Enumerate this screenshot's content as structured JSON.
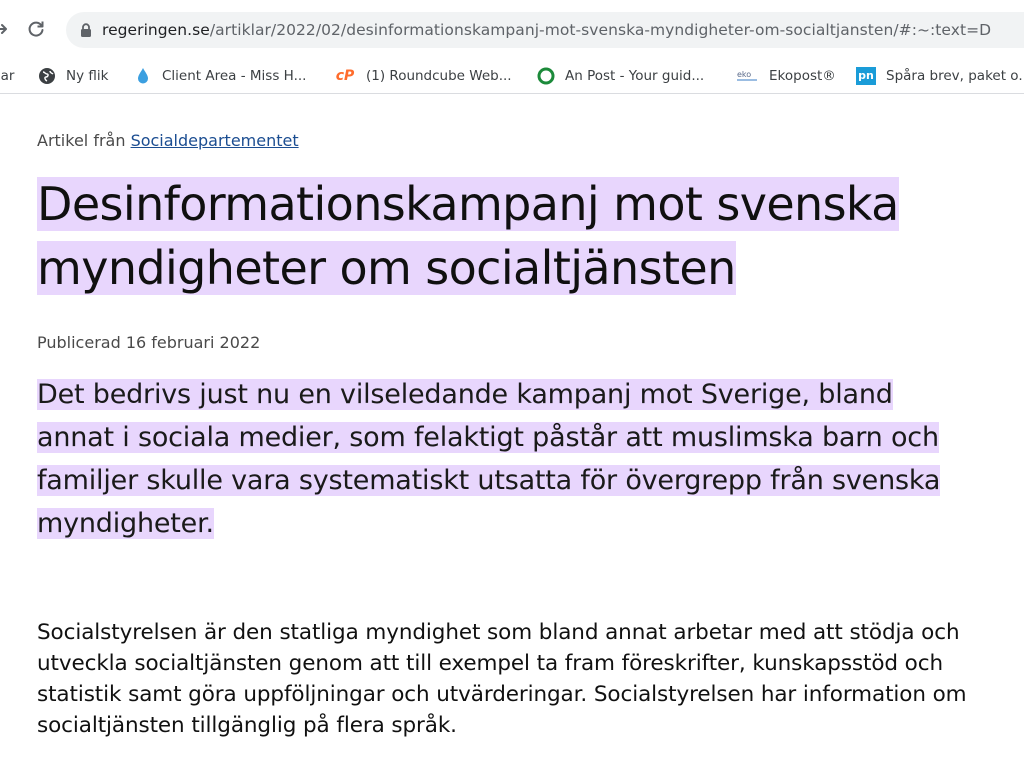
{
  "browser": {
    "url_host": "regeringen.se",
    "url_path": "/artiklar/2022/02/desinformationskampanj-mot-svenska-myndigheter-om-socialtjansten/#:~:text=D",
    "bookmarks": [
      {
        "label": "par",
        "icon": "partial-icon"
      },
      {
        "label": "Ny flik",
        "icon": "globe-icon"
      },
      {
        "label": "Client Area - Miss H...",
        "icon": "drop-icon"
      },
      {
        "label": "(1) Roundcube Web...",
        "icon": "cpanel-icon"
      },
      {
        "label": "An Post - Your guid...",
        "icon": "circle-icon"
      },
      {
        "label": "Ekopost®",
        "icon": "eko-icon"
      },
      {
        "label": "Spåra brev, paket o...",
        "icon": "pn-icon"
      }
    ]
  },
  "article": {
    "breadcrumb_prefix": "Artikel från",
    "breadcrumb_link": "Socialdepartementet",
    "title_line1": "Desinformationskampanj mot svenska",
    "title_line2": "myndigheter om socialtjänsten",
    "published": "Publicerad 16 februari 2022",
    "lead": "Det bedrivs just nu en vilseledande kampanj mot Sverige, bland annat i sociala medier, som felaktigt påstår att muslimska barn och familjer skulle vara systematiskt utsatta för övergrepp från svenska myndigheter.",
    "body": "Socialstyrelsen är den statliga myndighet som bland annat arbetar med att stödja och utveckla socialtjänsten genom att till exempel ta fram föreskrifter, kunskapsstöd och statistik samt göra uppföljningar och utvärderingar. Socialstyrelsen har information om socialtjänsten tillgänglig på flera språk."
  },
  "colors": {
    "highlight": "#e8d6fd",
    "link": "#1b4d91"
  }
}
